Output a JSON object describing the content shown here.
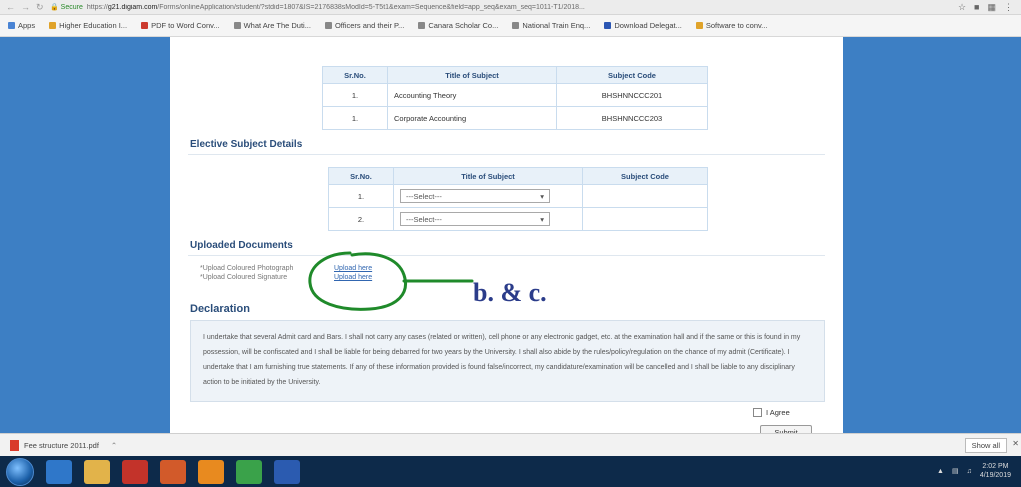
{
  "browser": {
    "secure_label": "Secure",
    "url_prefix": "https://",
    "url_host": "g21.digiam.com",
    "url_rest": "/Forms/onlineApplication/student/?stdid=1807&IS=2176838sModId=5-T5t1&exam=Sequence&field=app_seq&exam_seq=1011-T1/2018..."
  },
  "bookmarks": [
    {
      "label": "Apps",
      "color": "#4a84d4"
    },
    {
      "label": "Higher Education I...",
      "color": "#e0a32a"
    },
    {
      "label": "PDF to Word Conv...",
      "color": "#cc3a2e"
    },
    {
      "label": "What Are The Duti...",
      "color": "#888888"
    },
    {
      "label": "Officers and their P...",
      "color": "#888888"
    },
    {
      "label": "Canara Scholar Co...",
      "color": "#888888"
    },
    {
      "label": "National Train Enq...",
      "color": "#888888"
    },
    {
      "label": "Download Delegat...",
      "color": "#2b56b3"
    },
    {
      "label": "Software to conv...",
      "color": "#e0a32a"
    }
  ],
  "compulsory": {
    "headers": [
      "Sr.No.",
      "Title of Subject",
      "Subject Code"
    ],
    "rows": [
      {
        "sr": "1.",
        "title": "Accounting Theory",
        "code": "BHSHNNCCC201"
      },
      {
        "sr": "1.",
        "title": "Corporate Accounting",
        "code": "BHSHNNCCC203"
      }
    ]
  },
  "elective": {
    "title": "Elective Subject Details",
    "headers": [
      "Sr.No.",
      "Title of Subject",
      "Subject Code"
    ],
    "rows": [
      {
        "sr": "1.",
        "select": "---Select---"
      },
      {
        "sr": "2.",
        "select": "---Select---"
      }
    ]
  },
  "uploads": {
    "title": "Uploaded Documents",
    "items": [
      {
        "label": "*Upload Coloured Photograph",
        "link": "Upload here"
      },
      {
        "label": "*Upload Coloured Signature",
        "link": "Upload here"
      }
    ]
  },
  "annotation": {
    "text": "b. & c.",
    "color": "#1f8a2a"
  },
  "declaration": {
    "title": "Declaration",
    "text": "I undertake that several Admit card and Bars. I shall not carry any cases (related or written), cell phone or any electronic gadget, etc. at the examination hall and if the same or this is found in my possession, will be confiscated and I shall be liable for being debarred for two years by the University. I shall also abide by the rules/policy/regulation on the chance of my admit (Certificate). I undertake that I am furnishing true statements. If any of these information provided is found false/incorrect, my candidature/examination will be cancelled and I shall be liable to any disciplinary action to be initiated by the University.",
    "agree_label": "I Agree",
    "submit_label": "Submit"
  },
  "downloads": {
    "file": "Fee structure 2011.pdf",
    "show_all": "Show all"
  },
  "taskbar": {
    "time": "2:02 PM",
    "date": "4/19/2019"
  }
}
